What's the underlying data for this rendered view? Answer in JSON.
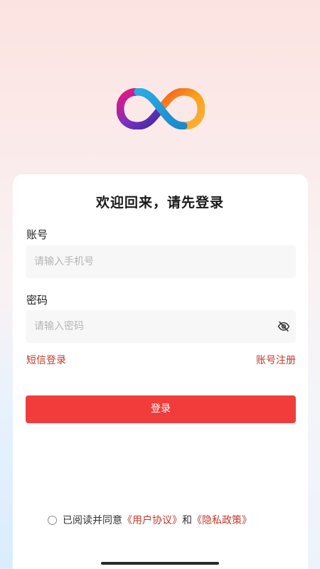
{
  "logo": {
    "icon": "infinity-logo-icon"
  },
  "login": {
    "title": "欢迎回来，请先登录",
    "account_label": "账号",
    "account_placeholder": "请输入手机号",
    "account_value": "",
    "password_label": "密码",
    "password_placeholder": "请输入密码",
    "password_value": "",
    "password_toggle_icon": "eye-off-icon",
    "sms_login": "短信登录",
    "register": "账号注册",
    "submit": "登录"
  },
  "agreement": {
    "prefix": "已阅读并同意",
    "user_agreement": "《用户协议》",
    "conjunction": "和",
    "privacy_policy": "《隐私政策》",
    "checked": false
  },
  "colors": {
    "accent": "#f23c3c",
    "link": "#c0392b",
    "input_bg": "#f7f7f7",
    "placeholder": "#b5b5b5"
  }
}
